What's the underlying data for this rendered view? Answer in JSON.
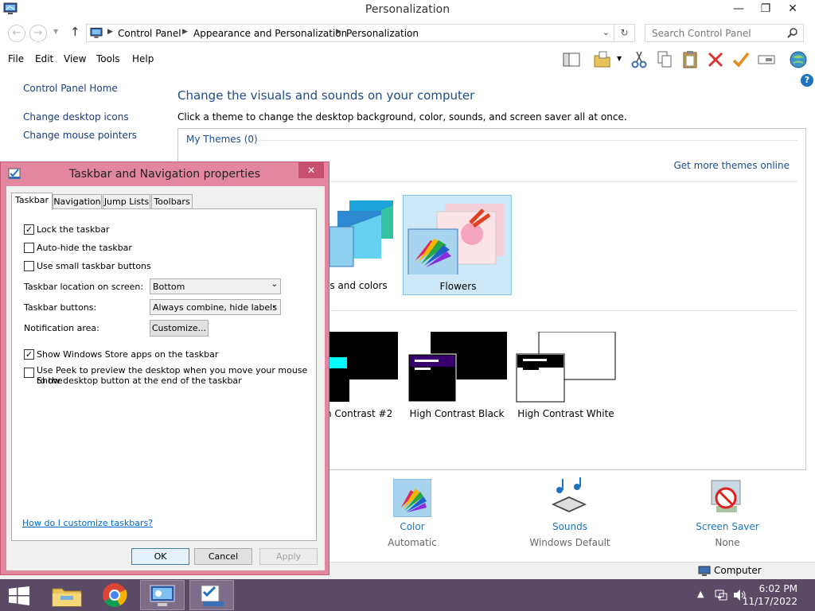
{
  "window": {
    "title": "Personalization"
  },
  "address": {
    "crumbs": [
      "Control Panel",
      "Appearance and Personalization",
      "Personalization"
    ],
    "search_placeholder": "Search Control Panel"
  },
  "menubar": [
    "File",
    "Edit",
    "View",
    "Tools",
    "Help"
  ],
  "sidebar": {
    "items": [
      "Control Panel Home",
      "Change desktop icons",
      "Change mouse pointers"
    ]
  },
  "main": {
    "heading": "Change the visuals and sounds on your computer",
    "subheading": "Click a theme to change the desktop background, color, sounds, and screen saver all at once.",
    "my_themes": "My Themes (0)",
    "get_more": "Get more themes online",
    "themes": [
      {
        "label": "es and colors"
      },
      {
        "label": "Flowers"
      }
    ],
    "contrast_themes": [
      {
        "label": "h Contrast #2"
      },
      {
        "label": "High Contrast Black"
      },
      {
        "label": "High Contrast White"
      }
    ]
  },
  "bottom": {
    "color": {
      "title": "Color",
      "sub": "Automatic"
    },
    "sounds": {
      "title": "Sounds",
      "sub": "Windows Default"
    },
    "screensaver": {
      "title": "Screen Saver",
      "sub": "None"
    }
  },
  "statusbar": {
    "computer": "Computer"
  },
  "dialog": {
    "title": "Taskbar and Navigation properties",
    "tabs": [
      "Taskbar",
      "Navigation",
      "Jump Lists",
      "Toolbars"
    ],
    "checks": {
      "lock": {
        "label": "Lock the taskbar",
        "checked": true
      },
      "autohide": {
        "label": "Auto-hide the taskbar",
        "checked": false
      },
      "small": {
        "label": "Use small taskbar buttons",
        "checked": false
      },
      "store": {
        "label": "Show Windows Store apps on the taskbar",
        "checked": true
      },
      "peek": {
        "label_line1": "Use Peek to preview the desktop when you move your mouse to the",
        "label_line2": "Show desktop button at the end of the taskbar",
        "checked": false
      }
    },
    "location_label": "Taskbar location on screen:",
    "location_value": "Bottom",
    "buttons_label": "Taskbar buttons:",
    "buttons_value": "Always combine, hide labels",
    "notification_label": "Notification area:",
    "customize": "Customize...",
    "help_link": "How do I customize taskbars?",
    "ok": "OK",
    "cancel": "Cancel",
    "apply": "Apply"
  },
  "taskbar": {
    "time": "6:02 PM",
    "date": "11/17/2022"
  },
  "colors": {
    "dialog_frame": "#e3869f",
    "taskbar": "#5b4a66",
    "link": "#1e4d8c"
  }
}
